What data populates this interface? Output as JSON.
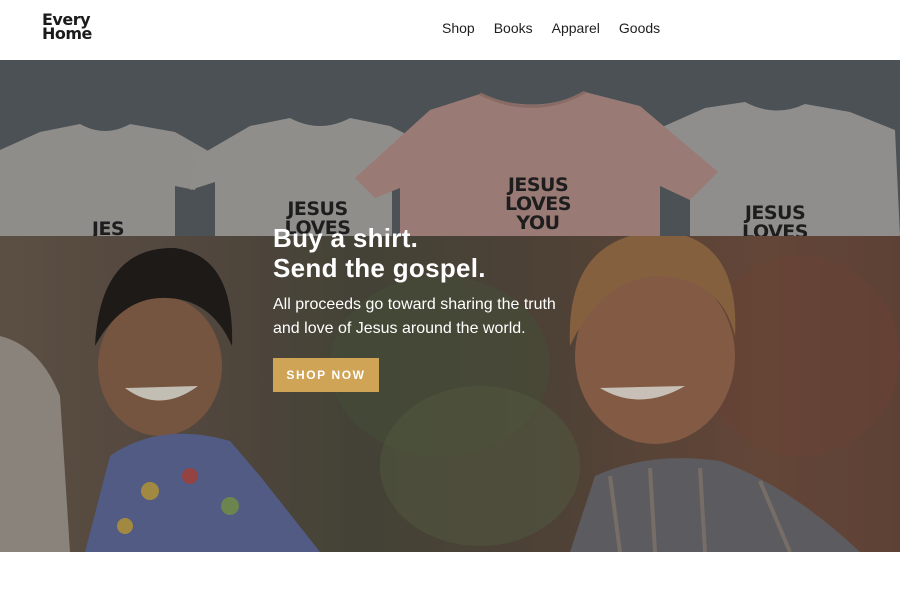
{
  "header": {
    "logo_line1": "Every",
    "logo_line2": "Home",
    "nav": [
      "Shop",
      "Books",
      "Apparel",
      "Goods"
    ]
  },
  "hero": {
    "title_line1": "Buy a shirt.",
    "title_line2": "Send the gospel.",
    "subtitle": "All proceeds go toward sharing the truth and love of Jesus around the world.",
    "cta_label": "SHOP NOW",
    "shirts": [
      {
        "text": "JES"
      },
      {
        "text": "JESUS LOVES"
      },
      {
        "text": "JESUS LOVES YOU"
      },
      {
        "text": "JESUS LOVES"
      }
    ]
  },
  "colors": {
    "accent": "#cfa456",
    "header_bg": "#ffffff",
    "hero_text": "#ffffff"
  }
}
